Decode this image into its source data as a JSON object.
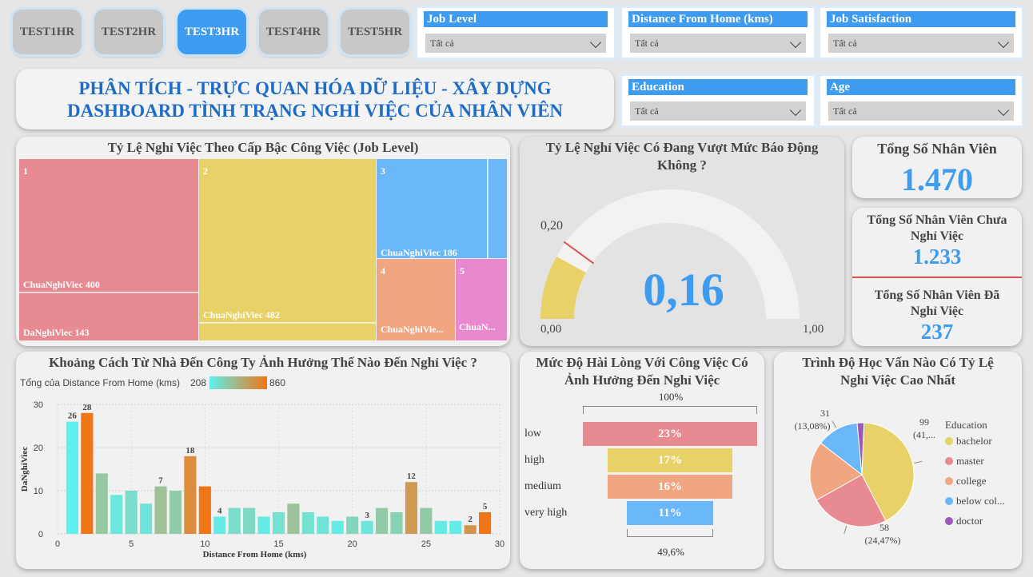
{
  "nav": [
    {
      "label": "TEST1HR",
      "active": false
    },
    {
      "label": "TEST2HR",
      "active": false
    },
    {
      "label": "TEST3HR",
      "active": true
    },
    {
      "label": "TEST4HR",
      "active": false
    },
    {
      "label": "TEST5HR",
      "active": false
    }
  ],
  "slicers": {
    "job_level": {
      "title": "Job Level",
      "value": "Tất cả"
    },
    "distance": {
      "title": "Distance From Home (kms)",
      "value": "Tất cả"
    },
    "job_satisfaction": {
      "title": "Job Satisfaction",
      "value": "Tất cả"
    },
    "education": {
      "title": "Education",
      "value": "Tất cả"
    },
    "age": {
      "title": "Age",
      "value": "Tất cả"
    }
  },
  "title": {
    "line1": "PHÂN TÍCH - TRỰC QUAN HÓA DỮ LIỆU - XÂY DỰNG",
    "line2": "DASHBOARD TÌNH TRẠNG NGHỈ VIỆC CỦA NHÂN VIÊN"
  },
  "treemap": {
    "title": "Tỷ Lệ Nghỉ Việc Theo Cấp Bậc Công Việc (Job Level)",
    "labels": {
      "l1": "1",
      "l1_a": "ChuaNghiViec 400",
      "l1_b": "DaNghiViec 143",
      "l2": "2",
      "l2_a": "ChuaNghiViec 482",
      "l3": "3",
      "l3_a": "ChuaNghiViec 186",
      "l4": "4",
      "l4_a": "ChuaNghiVie...",
      "l5": "5",
      "l5_a": "ChuaN..."
    },
    "colors": {
      "l1": "#e88a92",
      "l2": "#e8d166",
      "l3": "#6ab7fa",
      "l4": "#f0a680",
      "l5": "#e889cf"
    }
  },
  "gauge": {
    "title": "Tỷ Lệ Nghỉ Việc Có Đang Vượt Mức Báo Động Không ?",
    "value": 0.16,
    "value_label": "0,16",
    "min_label": "0,00",
    "max_label": "1,00",
    "target_label": "0,20",
    "target": 0.2
  },
  "kpi": {
    "total_label": "Tổng Số Nhân Viên",
    "total_value": "1.470",
    "stay_label": "Tổng Số Nhân Viên Chưa Nghỉ Việc",
    "stay_value": "1.233",
    "left_label": "Tổng Số Nhân Viên Đã Nghỉ Việc",
    "left_value": "237"
  },
  "distance_chart": {
    "title": "Khoảng Cách Từ Nhà Đến Công Ty Ảnh Hưởng Thế Nào Đến Nghỉ Việc ?",
    "legend_label": "Tổng của Distance From Home (kms)",
    "legend_min": "208",
    "legend_max": "860"
  },
  "funnel": {
    "title_line1": "Mức Độ Hài Lòng Với Công Việc Có",
    "title_line2": "Ảnh Hưởng Đến Nghỉ Việc",
    "top_label": "100%",
    "bottom_label": "49,6%",
    "items": [
      {
        "label": "low",
        "value": "23%",
        "fraction": 1.0,
        "color": "#e88a92"
      },
      {
        "label": "high",
        "value": "17%",
        "fraction": 0.72,
        "color": "#e8d166"
      },
      {
        "label": "medium",
        "value": "16%",
        "fraction": 0.72,
        "color": "#f0a680"
      },
      {
        "label": "very high",
        "value": "11%",
        "fraction": 0.496,
        "color": "#6ab7fa"
      }
    ]
  },
  "pie_card": {
    "title_line1": "Trình Độ Học Vấn Nào Có Tỷ Lệ",
    "title_line2": "Nghỉ Việc Cao Nhất",
    "legend_title": "Education"
  },
  "chart_data": [
    {
      "type": "bar",
      "title": "Khoảng Cách Từ Nhà Đến Công Ty Ảnh Hưởng Thế Nào Đến Nghỉ Việc ?",
      "xlabel": "Distance From Home (kms)",
      "ylabel": "DaNghiViec",
      "xlim": [
        0,
        30
      ],
      "ylim": [
        0,
        30
      ],
      "xticks": [
        0,
        5,
        10,
        15,
        20,
        25,
        30
      ],
      "yticks": [
        0,
        10,
        20,
        30
      ],
      "grid": true,
      "x": [
        1,
        2,
        3,
        4,
        5,
        6,
        7,
        8,
        9,
        10,
        11,
        12,
        13,
        14,
        15,
        16,
        17,
        18,
        19,
        20,
        21,
        22,
        23,
        24,
        25,
        26,
        27,
        28,
        29
      ],
      "values": [
        26,
        28,
        14,
        9,
        10,
        7,
        11,
        10,
        18,
        11,
        4,
        6,
        6,
        4,
        5,
        7,
        5,
        4,
        3,
        4,
        3,
        6,
        5,
        12,
        6,
        3,
        3,
        2,
        5
      ],
      "color_values": [
        208,
        860,
        400,
        250,
        300,
        260,
        430,
        380,
        720,
        860,
        230,
        300,
        320,
        230,
        280,
        420,
        280,
        270,
        230,
        330,
        260,
        390,
        350,
        640,
        390,
        230,
        230,
        660,
        860
      ],
      "data_labels": {
        "1": "26",
        "2": "28",
        "7": "7",
        "9": "18",
        "11": "4",
        "21": "3",
        "24": "12",
        "28": "2",
        "29": "5"
      }
    },
    {
      "type": "pie",
      "title": "Trình Độ Học Vấn Nào Có Tỷ Lệ Nghỉ Việc Cao Nhất",
      "legend_title": "Education",
      "legend_position": "right",
      "slices": [
        {
          "name": "bachelor",
          "value": 99,
          "color": "#e8d166",
          "label": "99",
          "sublabel": "(41,..."
        },
        {
          "name": "master",
          "value": 58,
          "color": "#e88a92",
          "label": "58",
          "sublabel": "(24,47%)"
        },
        {
          "name": "college",
          "value": 44,
          "color": "#f0a680",
          "label": "",
          "sublabel": ""
        },
        {
          "name": "below col...",
          "value": 31,
          "color": "#6ab7fa",
          "label": "31",
          "sublabel": "(13,08%)"
        },
        {
          "name": "doctor",
          "value": 5,
          "color": "#9b59b6",
          "label": "",
          "sublabel": ""
        }
      ]
    }
  ]
}
